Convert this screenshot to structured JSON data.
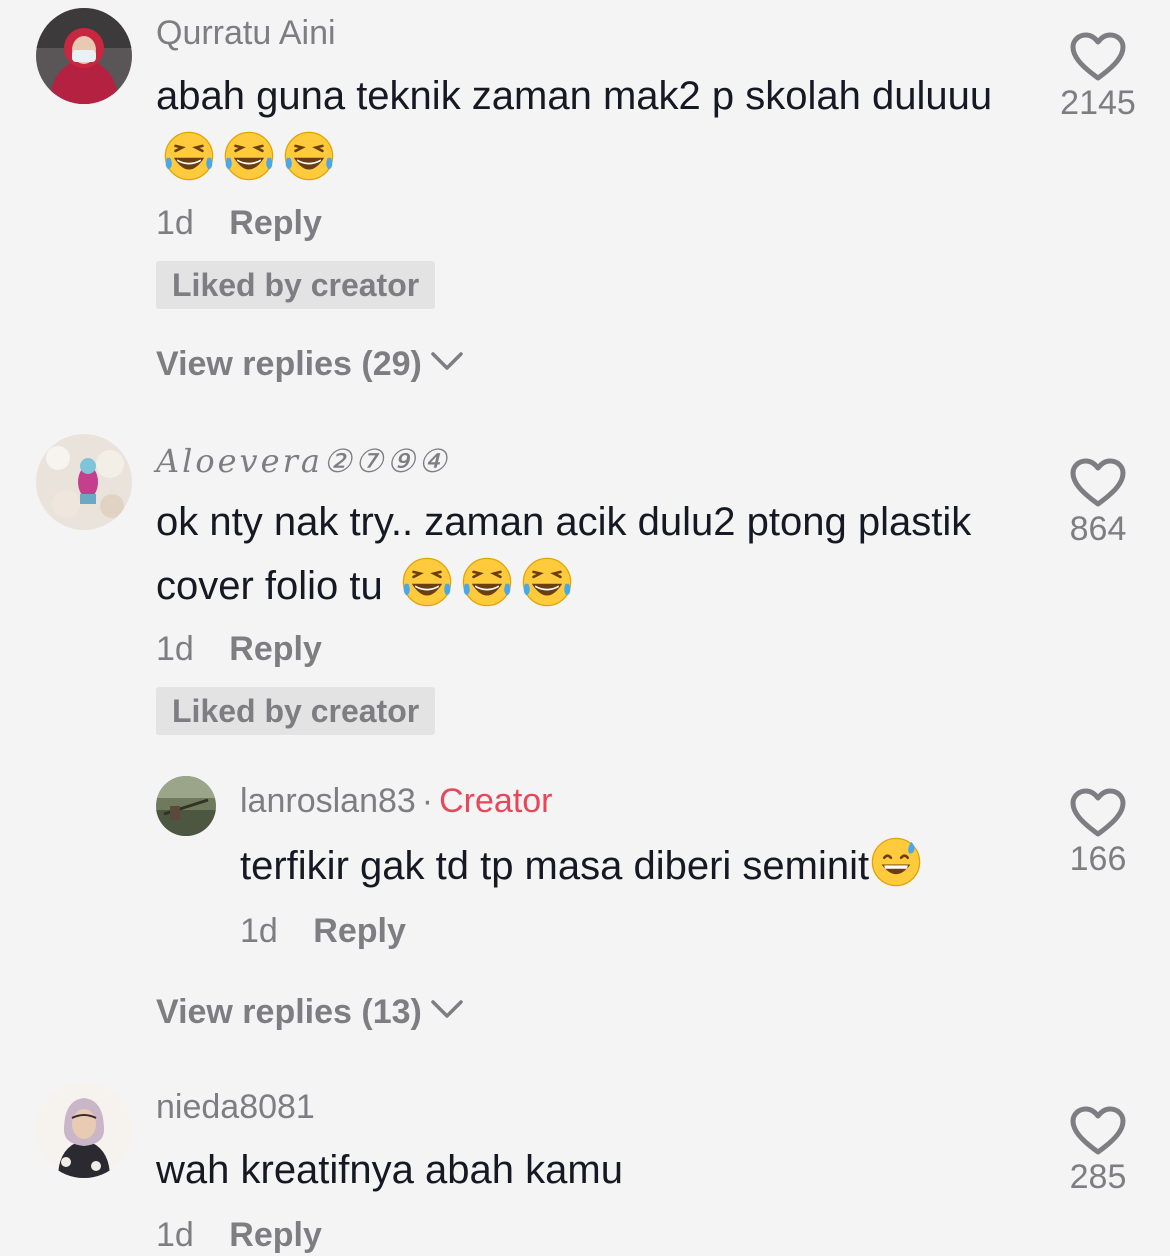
{
  "comments": [
    {
      "username": "Qurratu Aini",
      "text": "abah guna teknik zaman mak2 p skolah duluuu",
      "emoji": "face-with-tears-of-joy x3",
      "time": "1d",
      "reply_label": "Reply",
      "liked_badge": "Liked by creator",
      "likes": "2145",
      "view_replies": "View replies (29)"
    },
    {
      "username": "Aloevera②⑦⑨④",
      "text": "ok nty nak try.. zaman acik dulu2 ptong plastik cover folio tu",
      "emoji": "face-with-tears-of-joy x3",
      "time": "1d",
      "reply_label": "Reply",
      "liked_badge": "Liked by creator",
      "likes": "864",
      "reply": {
        "username": "lanroslan83",
        "separator": "·",
        "badge": "Creator",
        "text": "terfikir gak td tp masa diberi seminit",
        "emoji": "grinning-face-with-sweat",
        "time": "1d",
        "reply_label": "Reply",
        "likes": "166"
      },
      "view_replies": "View replies (13)"
    },
    {
      "username": "nieda8081",
      "text": "wah kreatifnya abah kamu",
      "time": "1d",
      "reply_label": "Reply",
      "likes": "285"
    }
  ],
  "colors": {
    "background": "#f4f4f4",
    "text": "#161823",
    "muted": "#7d7d82",
    "creator": "#e8475a",
    "badge_bg": "#e3e3e3"
  },
  "icons": [
    "heart-outline-icon",
    "chevron-down-icon",
    "laughing-emoji-icon",
    "sweat-smile-emoji-icon"
  ]
}
